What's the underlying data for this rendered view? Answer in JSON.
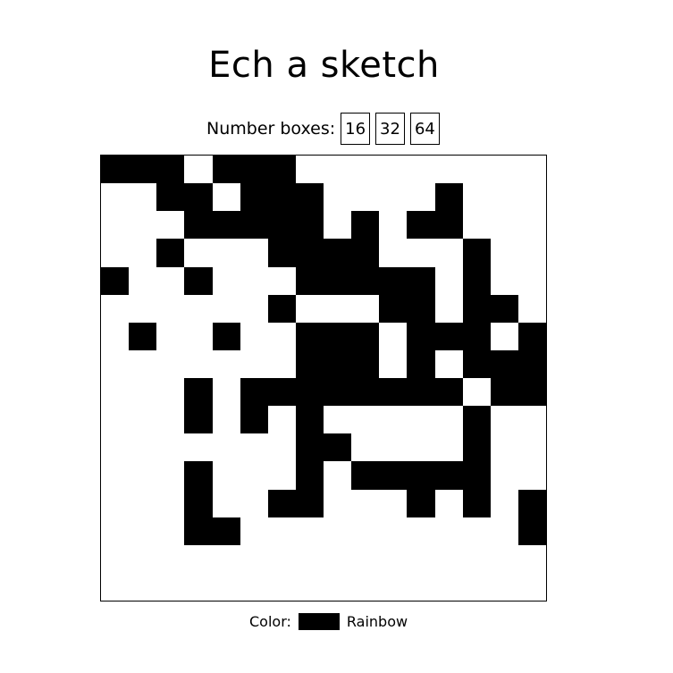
{
  "app": {
    "title": "Ech a sketch"
  },
  "controls": {
    "label": "Number boxes:",
    "sizes": [
      "16",
      "32",
      "64"
    ]
  },
  "grid": {
    "size": 16,
    "ink_color": "#000000",
    "rows": [
      "1110111000000000",
      "0011011100001000",
      "0001111101011000",
      "0010001111000100",
      "1001000111110100",
      "0000001000110110",
      "0100100111011101",
      "0000000111010111",
      "0001011111111011",
      "0001010100000100",
      "0000000110000100",
      "0001000101111100",
      "0001001100010101",
      "0001100000000001",
      "0000000000000000",
      "0000000000000000"
    ]
  },
  "footer": {
    "color_label": "Color:",
    "color_value": "#000000",
    "rainbow_label": "Rainbow"
  }
}
